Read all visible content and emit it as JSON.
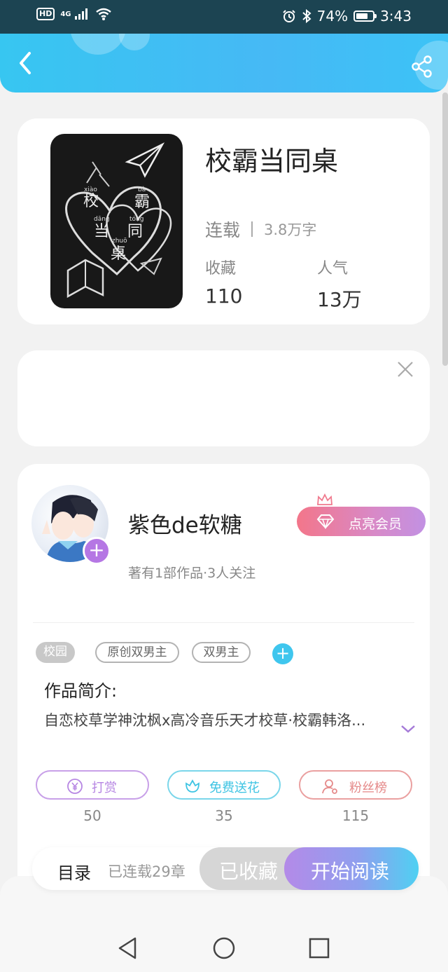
{
  "status_bar": {
    "hd": "HD",
    "network": "4G",
    "battery": "74%",
    "battery_level": 0.74,
    "time": "3:43"
  },
  "icons": {
    "back": "back-arrow-icon",
    "share": "share-icon",
    "close": "close-icon",
    "expand": "chevron-down-icon",
    "diamond": "diamond-icon",
    "crown": "crown-icon",
    "reward": "yen-coin-icon",
    "flower": "flower-icon",
    "fans": "person-icon"
  },
  "book": {
    "title": "校霸当同桌",
    "status": "连载",
    "word_count": "3.8万字",
    "favorites_label": "收藏",
    "favorites_value": "110",
    "popularity_label": "人气",
    "popularity_value": "13万",
    "cover": {
      "chars": [
        "校",
        "霸",
        "当",
        "同",
        "桌"
      ],
      "pinyin": [
        "xiào",
        "bà",
        "dāng",
        "tóng",
        "zhuō"
      ]
    }
  },
  "author": {
    "name": "紫色de软糖",
    "meta": "著有1部作品·3人关注",
    "follow_plus": "+",
    "vip_button": "点亮会员"
  },
  "tags": [
    {
      "label": "校园",
      "style": "filled"
    },
    {
      "label": "原创双男主",
      "style": "outline"
    },
    {
      "label": "双男主",
      "style": "outline"
    }
  ],
  "tag_add": "+",
  "intro": {
    "title": "作品简介:",
    "text": "自恋校草学神沈枫x高冷音乐天才校草·校霸韩洛..."
  },
  "actions": [
    {
      "label": "打赏",
      "count": "50",
      "color": "#b787e3"
    },
    {
      "label": "免费送花",
      "count": "35",
      "color": "#3ec4e3"
    },
    {
      "label": "粉丝榜",
      "count": "115",
      "color": "#e58a8a"
    }
  ],
  "read_bar": {
    "toc": "目录",
    "chapters": "已连载29章",
    "collected": "已收藏",
    "start": "开始阅读"
  },
  "colors": {
    "header": "#37c6f1",
    "accent_purple": "#b577e4",
    "accent_blue": "#3fc6ee"
  }
}
